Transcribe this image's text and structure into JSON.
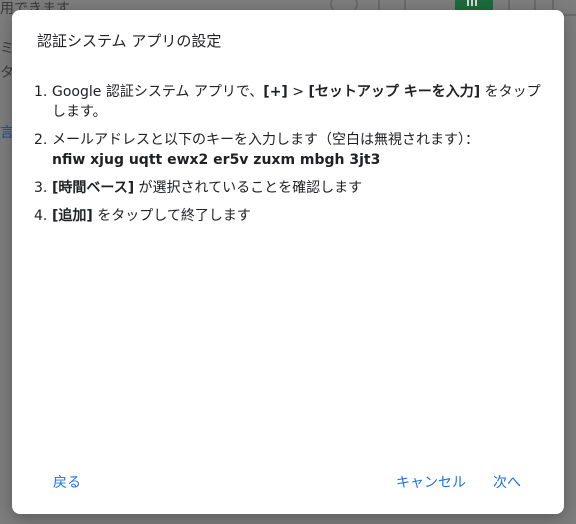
{
  "background": {
    "line1": "用できます",
    "line2": "ミ",
    "line3": "タ",
    "line4": "言"
  },
  "dialog": {
    "title": "認証システム アプリの設定",
    "steps": [
      {
        "num": "1.",
        "pre": "Google 認証システム アプリで、",
        "b1": "[+]",
        "mid": " > ",
        "b2": "[セットアップ キーを入力]",
        "post": " をタップします。"
      },
      {
        "num": "2.",
        "text": "メールアドレスと以下のキーを入力します（空白は無視されます）：",
        "key": "nfiw xjug uqtt ewx2 er5v zuxm mbgh 3jt3"
      },
      {
        "num": "3.",
        "bold": "[時間ベース]",
        "post": " が選択されていることを確認します"
      },
      {
        "num": "4.",
        "bold": "[追加]",
        "post": " をタップして終了します"
      }
    ],
    "buttons": {
      "back": "戻る",
      "cancel": "キャンセル",
      "next": "次へ"
    }
  },
  "colors": {
    "accent": "#1a73e8",
    "scrim": "#7d7d7d",
    "text": "#202124"
  }
}
